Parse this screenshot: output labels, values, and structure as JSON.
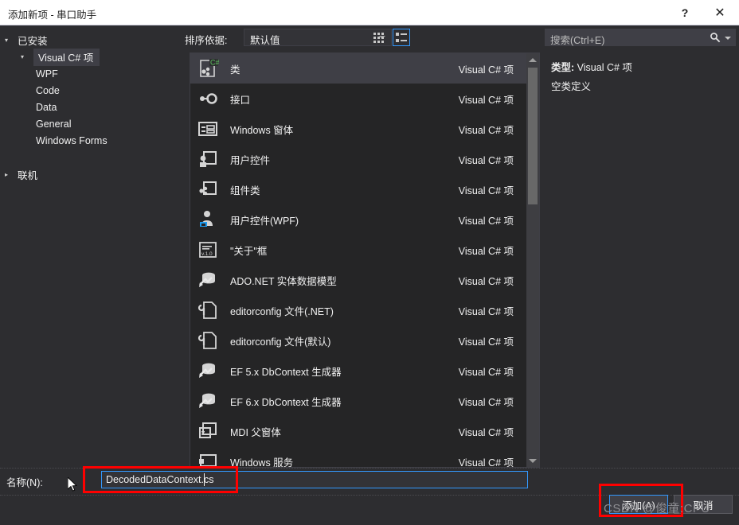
{
  "window": {
    "title": "添加新项 - 串口助手",
    "help_label": "?",
    "close_label": "✕"
  },
  "sidebar": {
    "root": {
      "label": "已安装",
      "arrow": "▾"
    },
    "items": [
      {
        "label": "Visual C# 项",
        "arrow": "▾",
        "selected": true,
        "level": "child"
      },
      {
        "label": "WPF",
        "level": "leaf"
      },
      {
        "label": "Code",
        "level": "leaf"
      },
      {
        "label": "Data",
        "level": "leaf"
      },
      {
        "label": "General",
        "level": "leaf"
      },
      {
        "label": "Windows Forms",
        "level": "leaf"
      }
    ],
    "online": {
      "label": "联机",
      "arrow": "▸"
    }
  },
  "toolbar": {
    "sort_label": "排序依据:",
    "sort_value": "默认值",
    "grid_view_icon": "grid-view-icon",
    "list_view_icon": "list-view-icon",
    "list_view_selected": true
  },
  "search": {
    "placeholder": "搜索(Ctrl+E)",
    "icon": "search-icon"
  },
  "templates": [
    {
      "name": "类",
      "kind": "Visual C# 项",
      "icon": "class-csharp-icon",
      "selected": true
    },
    {
      "name": "接口",
      "kind": "Visual C# 项",
      "icon": "interface-icon",
      "selected": false
    },
    {
      "name": "Windows 窗体",
      "kind": "Visual C# 项",
      "icon": "windows-form-icon",
      "selected": false
    },
    {
      "name": "用户控件",
      "kind": "Visual C# 项",
      "icon": "user-control-icon",
      "selected": false
    },
    {
      "name": "组件类",
      "kind": "Visual C# 项",
      "icon": "component-class-icon",
      "selected": false
    },
    {
      "name": "用户控件(WPF)",
      "kind": "Visual C# 项",
      "icon": "user-control-wpf-icon",
      "selected": false
    },
    {
      "name": "\"关于\"框",
      "kind": "Visual C# 项",
      "icon": "about-box-icon",
      "selected": false
    },
    {
      "name": "ADO.NET 实体数据模型",
      "kind": "Visual C# 项",
      "icon": "ado-net-model-icon",
      "selected": false
    },
    {
      "name": "editorconfig 文件(.NET)",
      "kind": "Visual C# 项",
      "icon": "editorconfig-icon",
      "selected": false
    },
    {
      "name": "editorconfig 文件(默认)",
      "kind": "Visual C# 项",
      "icon": "editorconfig-icon",
      "selected": false
    },
    {
      "name": "EF 5.x DbContext 生成器",
      "kind": "Visual C# 项",
      "icon": "ef-dbcontext-icon",
      "selected": false
    },
    {
      "name": "EF 6.x DbContext 生成器",
      "kind": "Visual C# 项",
      "icon": "ef-dbcontext-icon",
      "selected": false
    },
    {
      "name": "MDI 父窗体",
      "kind": "Visual C# 项",
      "icon": "mdi-parent-form-icon",
      "selected": false
    },
    {
      "name": "Windows 服务",
      "kind": "Visual C# 项",
      "icon": "windows-service-icon",
      "selected": false
    }
  ],
  "details": {
    "type_label": "类型:",
    "type_value": "Visual C# 项",
    "description": "空类定义"
  },
  "footer": {
    "name_label": "名称(N):",
    "name_value": "DecodedDataContext.cs",
    "add_button": "添加(A)",
    "cancel_button": "取消"
  },
  "watermark": "CSDN @俊童:CPU",
  "colors": {
    "dialog_bg": "#2d2d30",
    "list_bg": "#252526",
    "selection_bg": "#3f3f46",
    "accent_blue": "#3399ff",
    "annotation_red": "#ff0000",
    "titlebar_bg": "#ffffff",
    "text": "#f1f1f1"
  }
}
